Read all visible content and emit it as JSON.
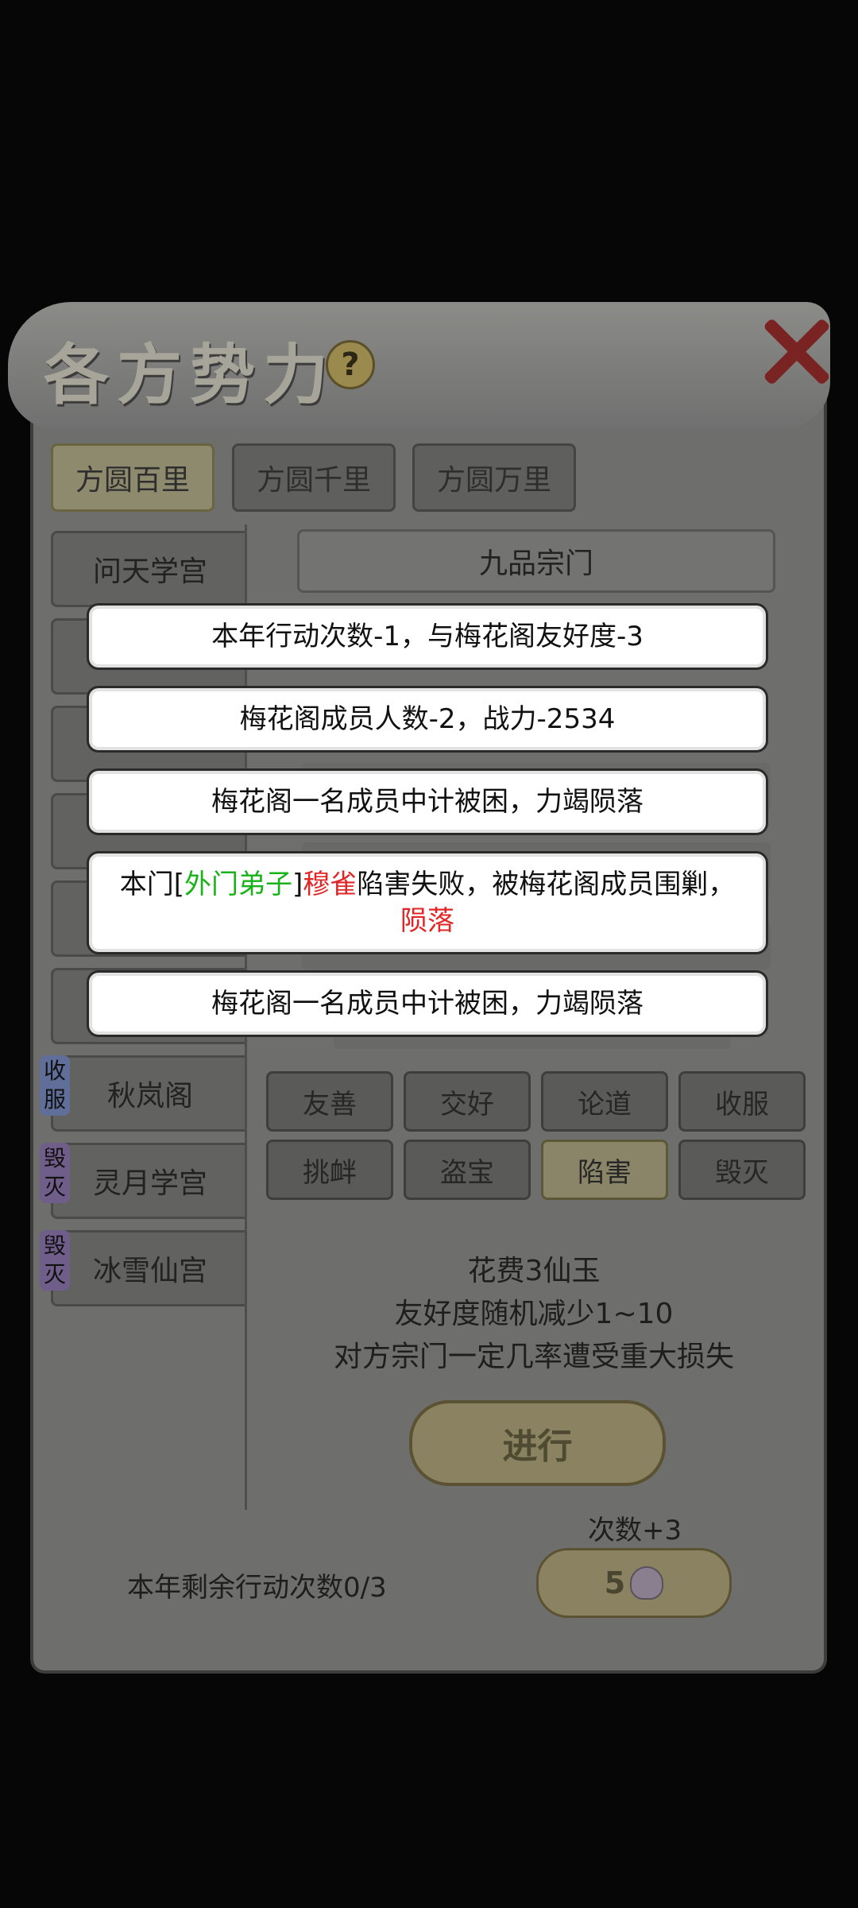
{
  "panel": {
    "title": "各方势力",
    "help_icon": "?",
    "close_icon": "close-icon"
  },
  "top_tabs": [
    "方圆百里",
    "方圆千里",
    "方圆万里"
  ],
  "sidebar": {
    "items": [
      {
        "label": "问天学宫"
      },
      {
        "label": ""
      },
      {
        "label": ""
      },
      {
        "label": ""
      },
      {
        "label": ""
      },
      {
        "label": ""
      },
      {
        "label": "秋岚阁",
        "badge": "收服"
      },
      {
        "label": "灵月学宫",
        "badge": "毁灭"
      },
      {
        "label": "冰雪仙宫",
        "badge": "毁灭"
      }
    ]
  },
  "sect_type": "九品宗门",
  "actions": {
    "row1": [
      "友善",
      "交好",
      "论道",
      "收服"
    ],
    "row2": [
      "挑衅",
      "盗宝",
      "陷害",
      "毁灭"
    ],
    "selected": "陷害"
  },
  "info": {
    "line1": "花费3仙玉",
    "line2": "友好度随机减少1~10",
    "line3": "对方宗门一定几率遭受重大损失"
  },
  "go_button": "进行",
  "extra_times": "次数+3",
  "remaining": "本年剩余行动次数0/3",
  "cost": "5",
  "toasts": {
    "t1": "本年行动次数-1，与梅花阁友好度-3",
    "t2": "梅花阁成员人数-2，战力-2534",
    "t3": "梅花阁一名成员中计被困，力竭陨落",
    "t4_prefix": "本门[",
    "t4_rank": "外门弟子",
    "t4_bracket": "]",
    "t4_name": "穆雀",
    "t4_mid": "陷害失败，被梅花阁成员围剿，",
    "t4_result": "陨落",
    "t5": "梅花阁一名成员中计被困，力竭陨落"
  },
  "colors": {
    "success_green": "#19b219",
    "danger_red": "#e02626"
  }
}
